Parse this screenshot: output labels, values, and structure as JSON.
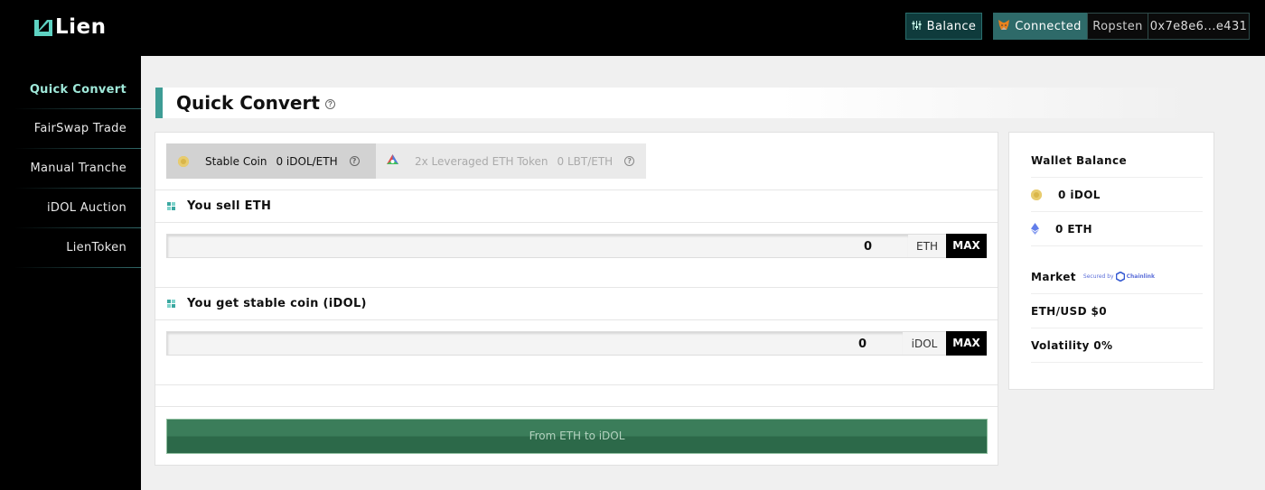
{
  "header": {
    "logo_text": "Lien",
    "balance_label": "Balance",
    "connected_label": "Connected",
    "network": "Ropsten",
    "address": "0x7e8e6...e431",
    "accent_color": "#3e9c95"
  },
  "sidebar": {
    "items": [
      {
        "label": "Quick Convert",
        "active": true
      },
      {
        "label": "FairSwap Trade",
        "active": false
      },
      {
        "label": "Manual Tranche",
        "active": false
      },
      {
        "label": "iDOL Auction",
        "active": false
      },
      {
        "label": "LienToken",
        "active": false
      }
    ]
  },
  "main": {
    "page_title": "Quick Convert",
    "help_glyph": "?",
    "tabs": [
      {
        "label": "Stable Coin",
        "value": "0 iDOL/ETH",
        "active": true
      },
      {
        "label": "2x Leveraged ETH Token",
        "value": "0 LBT/ETH",
        "active": false
      }
    ],
    "sell": {
      "label": "You sell ETH",
      "value": "0",
      "unit": "ETH",
      "max_label": "MAX"
    },
    "get": {
      "label": "You get stable coin (iDOL)",
      "value": "0",
      "unit": "iDOL",
      "max_label": "MAX"
    },
    "convert_button": "From ETH to iDOL"
  },
  "wallet": {
    "title": "Wallet Balance",
    "idol": "0 iDOL",
    "eth": "0 ETH",
    "market_label": "Market",
    "secured_by": "Secured by",
    "chainlink": "Chainlink",
    "eth_usd": "ETH/USD $0",
    "volatility": "Volatility 0%"
  }
}
